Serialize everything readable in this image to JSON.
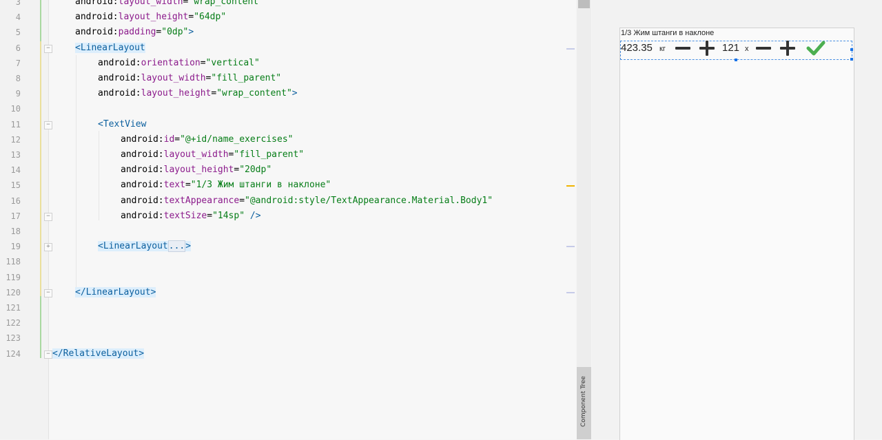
{
  "editor": {
    "lines": [
      {
        "num": "3",
        "segments": [
          {
            "t": "android",
            "c": "ns"
          },
          {
            "t": ":",
            "c": "ns"
          },
          {
            "t": "layout_width",
            "c": "attr"
          },
          {
            "t": "=",
            "c": "ns"
          },
          {
            "t": "\"wrap_content\"",
            "c": "val"
          }
        ]
      },
      {
        "num": "4",
        "segments": [
          {
            "t": "android",
            "c": "ns"
          },
          {
            "t": ":",
            "c": "ns"
          },
          {
            "t": "layout_height",
            "c": "attr"
          },
          {
            "t": "=",
            "c": "ns"
          },
          {
            "t": "\"64dp\"",
            "c": "val"
          }
        ]
      },
      {
        "num": "5",
        "segments": [
          {
            "t": "android",
            "c": "ns"
          },
          {
            "t": ":",
            "c": "ns"
          },
          {
            "t": "padding",
            "c": "attr"
          },
          {
            "t": "=",
            "c": "ns"
          },
          {
            "t": "\"0dp\"",
            "c": "val"
          },
          {
            "t": ">",
            "c": "tag"
          }
        ]
      },
      {
        "num": "6",
        "segments": [
          {
            "t": "<LinearLayout",
            "c": "tag hl"
          }
        ]
      },
      {
        "num": "7",
        "segments": [
          {
            "t": "android",
            "c": "ns"
          },
          {
            "t": ":",
            "c": "ns"
          },
          {
            "t": "orientation",
            "c": "attr"
          },
          {
            "t": "=",
            "c": "ns"
          },
          {
            "t": "\"vertical\"",
            "c": "val"
          }
        ]
      },
      {
        "num": "8",
        "segments": [
          {
            "t": "android",
            "c": "ns"
          },
          {
            "t": ":",
            "c": "ns"
          },
          {
            "t": "layout_width",
            "c": "attr"
          },
          {
            "t": "=",
            "c": "ns"
          },
          {
            "t": "\"fill_parent\"",
            "c": "val"
          }
        ]
      },
      {
        "num": "9",
        "segments": [
          {
            "t": "android",
            "c": "ns"
          },
          {
            "t": ":",
            "c": "ns"
          },
          {
            "t": "layout_height",
            "c": "attr"
          },
          {
            "t": "=",
            "c": "ns"
          },
          {
            "t": "\"wrap_content\"",
            "c": "val"
          },
          {
            "t": ">",
            "c": "tag"
          }
        ]
      },
      {
        "num": "10",
        "segments": []
      },
      {
        "num": "11",
        "segments": [
          {
            "t": "<TextView",
            "c": "tag"
          }
        ]
      },
      {
        "num": "12",
        "segments": [
          {
            "t": "android",
            "c": "ns"
          },
          {
            "t": ":",
            "c": "ns"
          },
          {
            "t": "id",
            "c": "attr"
          },
          {
            "t": "=",
            "c": "ns"
          },
          {
            "t": "\"@+id/name_exercises\"",
            "c": "val"
          }
        ]
      },
      {
        "num": "13",
        "segments": [
          {
            "t": "android",
            "c": "ns"
          },
          {
            "t": ":",
            "c": "ns"
          },
          {
            "t": "layout_width",
            "c": "attr"
          },
          {
            "t": "=",
            "c": "ns"
          },
          {
            "t": "\"fill_parent\"",
            "c": "val"
          }
        ]
      },
      {
        "num": "14",
        "segments": [
          {
            "t": "android",
            "c": "ns"
          },
          {
            "t": ":",
            "c": "ns"
          },
          {
            "t": "layout_height",
            "c": "attr"
          },
          {
            "t": "=",
            "c": "ns"
          },
          {
            "t": "\"20dp\"",
            "c": "val"
          }
        ]
      },
      {
        "num": "15",
        "segments": [
          {
            "t": "android",
            "c": "ns"
          },
          {
            "t": ":",
            "c": "ns"
          },
          {
            "t": "text",
            "c": "attr"
          },
          {
            "t": "=",
            "c": "ns"
          },
          {
            "t": "\"1/3 Жим штанги в наклоне\"",
            "c": "val"
          }
        ]
      },
      {
        "num": "16",
        "segments": [
          {
            "t": "android",
            "c": "ns"
          },
          {
            "t": ":",
            "c": "ns"
          },
          {
            "t": "textAppearance",
            "c": "attr"
          },
          {
            "t": "=",
            "c": "ns"
          },
          {
            "t": "\"@android:style/TextAppearance.Material.Body1\"",
            "c": "val"
          }
        ]
      },
      {
        "num": "17",
        "segments": [
          {
            "t": "android",
            "c": "ns"
          },
          {
            "t": ":",
            "c": "ns"
          },
          {
            "t": "textSize",
            "c": "attr"
          },
          {
            "t": "=",
            "c": "ns"
          },
          {
            "t": "\"14sp\"",
            "c": "val"
          },
          {
            "t": " />",
            "c": "tag"
          }
        ]
      },
      {
        "num": "18",
        "segments": []
      },
      {
        "num": "19",
        "segments": [
          {
            "t": "<LinearLayout",
            "c": "tag hl"
          },
          {
            "t": "...",
            "c": "tag folded"
          },
          {
            "t": ">",
            "c": "tag hl"
          }
        ]
      },
      {
        "num": "118",
        "segments": []
      },
      {
        "num": "119",
        "segments": []
      },
      {
        "num": "120",
        "segments": [
          {
            "t": "</LinearLayout>",
            "c": "tag hl"
          }
        ]
      },
      {
        "num": "121",
        "segments": []
      },
      {
        "num": "122",
        "segments": []
      },
      {
        "num": "123",
        "segments": []
      },
      {
        "num": "124",
        "segments": [
          {
            "t": "</RelativeLayout>",
            "c": "tag hl"
          }
        ]
      }
    ],
    "side_tab_label": "Component Tree"
  },
  "preview": {
    "title": "1/3 Жим штанги в наклоне",
    "weight": "423.35",
    "weight_unit": "кг",
    "reps": "121",
    "reps_unit": "x",
    "check_color": "#4caf50"
  }
}
